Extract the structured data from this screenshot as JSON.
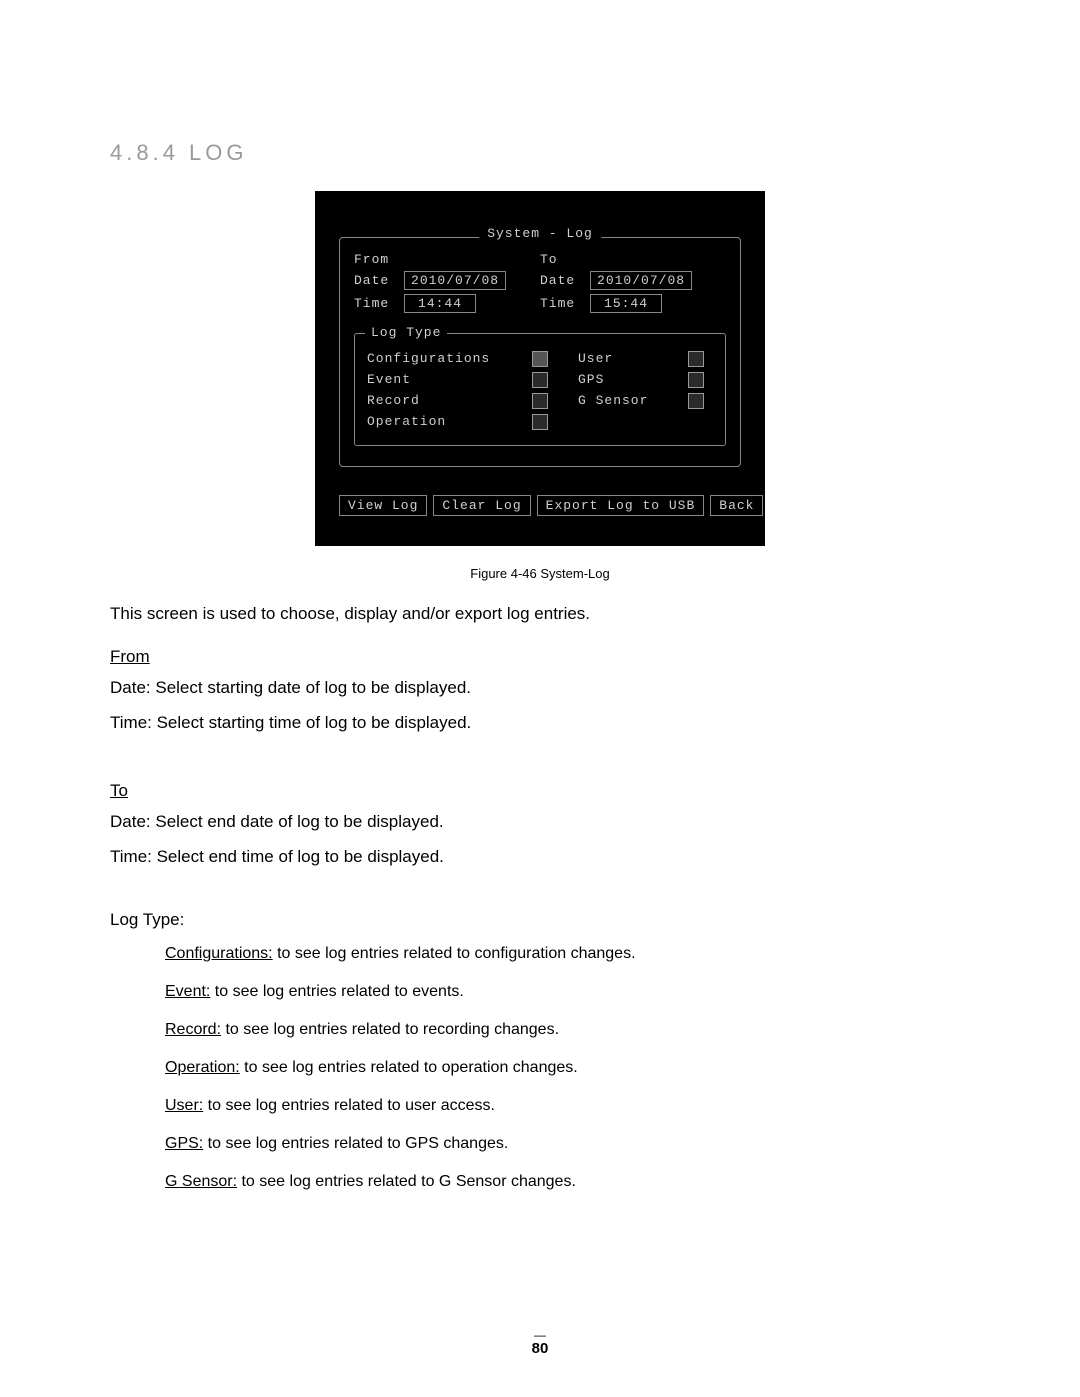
{
  "heading": "4.8.4 LOG",
  "dvr": {
    "title": "System - Log",
    "from_label": "From",
    "to_label": "To",
    "date_label": "Date",
    "time_label": "Time",
    "from_date": "2010/07/08",
    "from_time": "14:44",
    "to_date": "2010/07/08",
    "to_time": "15:44",
    "log_type_label": "Log Type",
    "opts": {
      "configurations": "Configurations",
      "event": "Event",
      "record": "Record",
      "operation": "Operation",
      "user": "User",
      "gps": "GPS",
      "gsensor": "G Sensor"
    },
    "buttons": {
      "view": "View Log",
      "clear": "Clear Log",
      "export": "Export Log to USB",
      "back": "Back"
    }
  },
  "caption": "Figure 4-46 System-Log",
  "intro": "This screen is used to choose, display and/or export log entries.",
  "from": {
    "head": "From",
    "date": "Date: Select starting date of log to be displayed.",
    "time": "Time: Select starting time of log to be displayed."
  },
  "to": {
    "head": "To",
    "date": "Date: Select end date of log to be displayed.",
    "time": "Time: Select end time of log to be displayed."
  },
  "logtype_head": "Log Type:",
  "items": {
    "configs_u": "Configurations:",
    "configs_t": " to see log entries related to configuration changes.",
    "event_u": "Event:",
    "event_t": " to see log entries related to events.",
    "record_u": "Record:",
    "record_t": " to see log entries related to recording changes.",
    "operation_u": "Operation:",
    "operation_t": " to see log entries related to operation changes.",
    "user_u": "User:",
    "user_t": " to see log entries related to user access.",
    "gps_u": "GPS:",
    "gps_t": " to see log entries related to GPS changes.",
    "gsensor_u": "G Sensor:",
    "gsensor_t": " to see log entries related to G Sensor changes."
  },
  "page_number": "80"
}
